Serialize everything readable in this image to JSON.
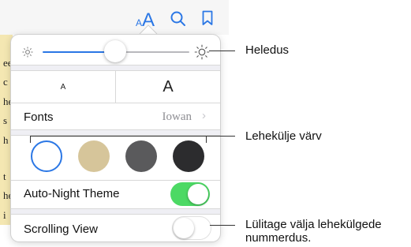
{
  "book": {
    "letters": [
      "ee",
      "c",
      "he",
      "s",
      "h",
      "t",
      "he",
      "i"
    ]
  },
  "toolbar": {
    "appearance_small_a": "A",
    "appearance_large_a": "A"
  },
  "popover": {
    "font_size": {
      "smaller_label": "A",
      "larger_label": "A"
    },
    "fonts": {
      "label": "Fonts",
      "value": "Iowan",
      "chevron": "›"
    },
    "brightness": {
      "level": 0.44
    },
    "page_colors": {
      "swatches": [
        {
          "name": "white",
          "color": "#ffffff",
          "selected": true
        },
        {
          "name": "sepia",
          "color": "#d6c59a",
          "selected": false
        },
        {
          "name": "gray",
          "color": "#5a5a5c",
          "selected": false
        },
        {
          "name": "night",
          "color": "#2c2c2e",
          "selected": false
        }
      ],
      "selection_color": "#2b77e5"
    },
    "auto_night": {
      "label": "Auto-Night Theme",
      "on": true
    },
    "scrolling_view": {
      "label": "Scrolling View",
      "on": false
    }
  },
  "colors": {
    "accent": "#2b77e5",
    "toggle_on": "#4cd964"
  },
  "callouts": {
    "brightness": "Heledus",
    "page_color": "Lehekülje värv",
    "scrolling": [
      "Lülitage välja lehekülgede",
      "nummerdus."
    ]
  }
}
